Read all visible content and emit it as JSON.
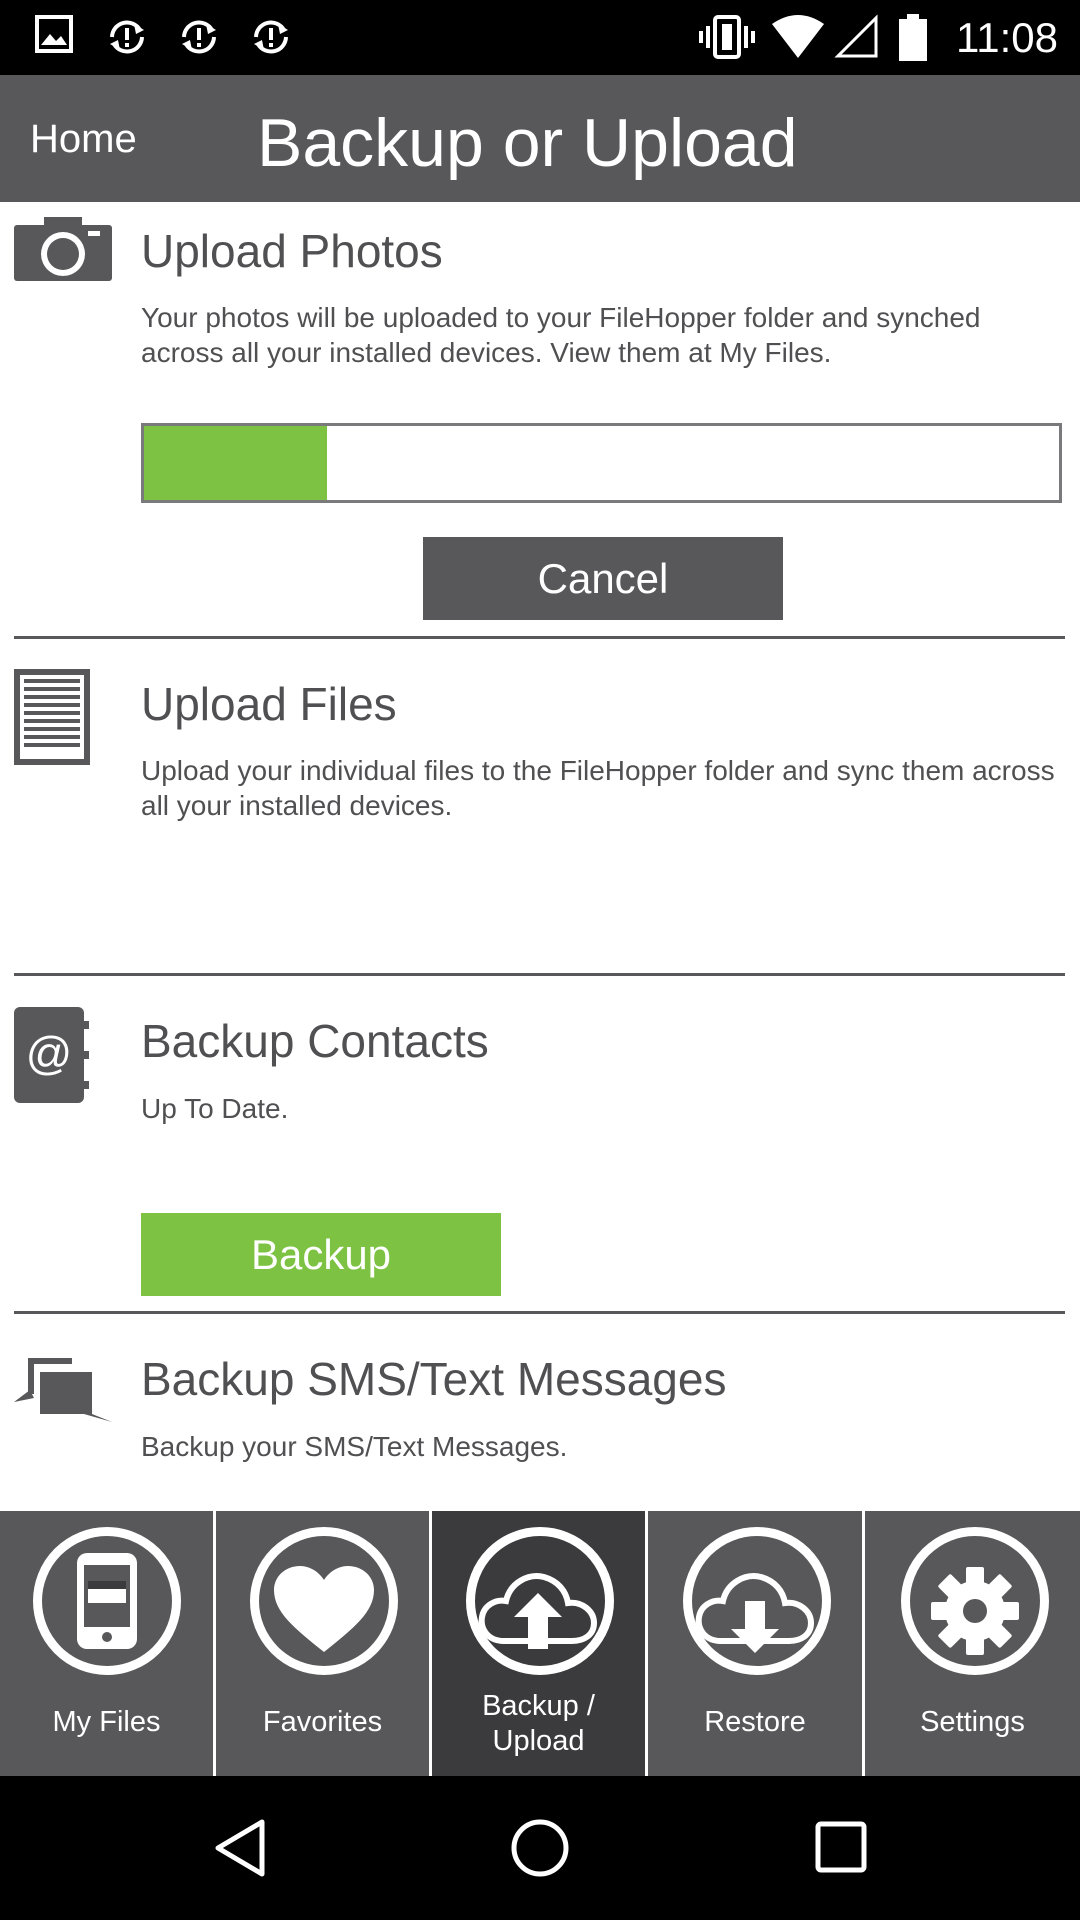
{
  "status_bar": {
    "time": "11:08",
    "left_icons": [
      "image-icon",
      "sync-icon",
      "sync-icon",
      "sync-icon"
    ],
    "right_icons": [
      "vibrate-icon",
      "wifi-icon",
      "signal-icon",
      "battery-icon"
    ]
  },
  "header": {
    "home_label": "Home",
    "title": "Backup or Upload"
  },
  "sections": {
    "photos": {
      "icon": "camera-icon",
      "title": "Upload Photos",
      "description": "Your photos will be uploaded to your FileHopper folder and synched across all your installed devices. View them at My Files.",
      "progress": 0.2,
      "cancel_label": "Cancel"
    },
    "files": {
      "icon": "document-icon",
      "title": "Upload Files",
      "description": "Upload your individual files to the FileHopper folder and sync them across all your installed devices."
    },
    "contacts": {
      "icon": "address-book-icon",
      "title": "Backup Contacts",
      "description": "Up To Date.",
      "backup_label": "Backup"
    },
    "sms": {
      "icon": "messages-icon",
      "title": "Backup SMS/Text Messages",
      "description": "Backup your SMS/Text Messages."
    }
  },
  "bottom_nav": {
    "items": [
      {
        "label": "My Files",
        "icon": "phone-icon",
        "active": false
      },
      {
        "label": "Favorites",
        "icon": "heart-icon",
        "active": false
      },
      {
        "label": "Backup / Upload",
        "icon": "cloud-upload-icon",
        "active": true
      },
      {
        "label": "Restore",
        "icon": "cloud-download-icon",
        "active": false
      },
      {
        "label": "Settings",
        "icon": "gear-icon",
        "active": false
      }
    ]
  },
  "colors": {
    "header": "#58585a",
    "accent_green": "#7dc242",
    "active_tab": "#3b3b3d"
  }
}
